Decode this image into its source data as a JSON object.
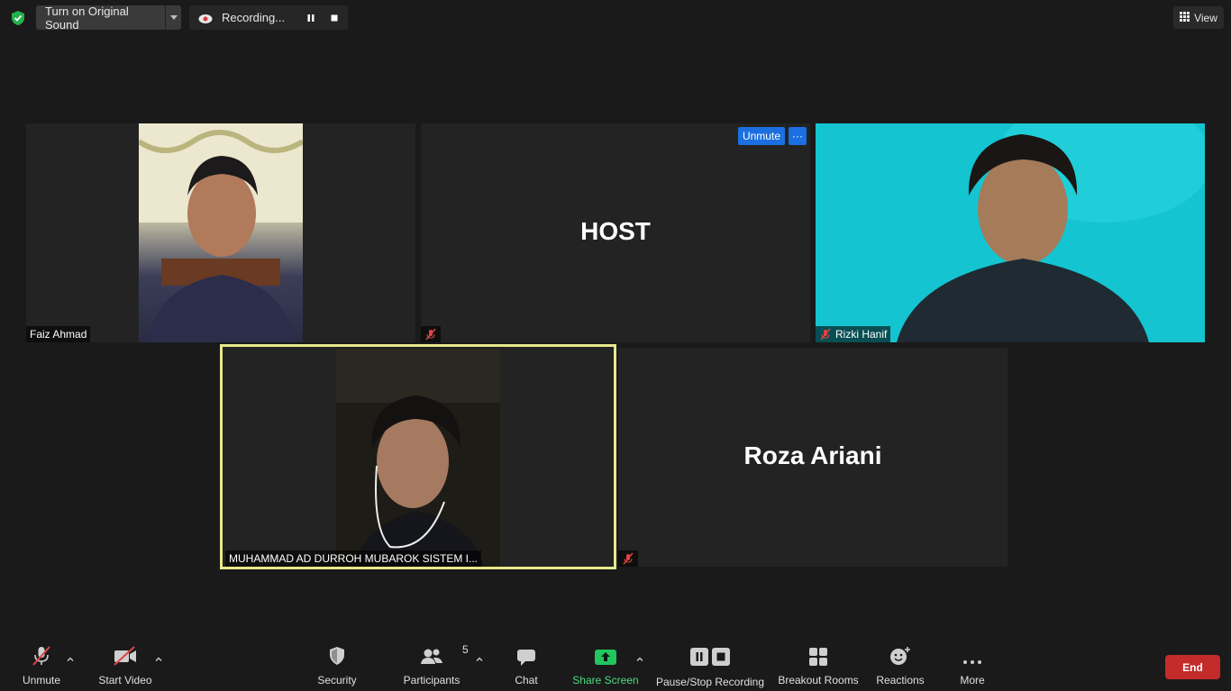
{
  "topbar": {
    "original_sound_label": "Turn on Original Sound",
    "recording_label": "Recording...",
    "view_label": "View"
  },
  "tiles": {
    "faiz": {
      "name": "Faiz Ahmad"
    },
    "host": {
      "name": "HOST",
      "unmute_label": "Unmute",
      "more_label": "···"
    },
    "rizki": {
      "name": "Rizki Hanif"
    },
    "muhammad": {
      "name": "MUHAMMAD AD DURROH MUBAROK SISTEM I..."
    },
    "roza": {
      "name": "Roza Ariani"
    }
  },
  "toolbar": {
    "unmute": "Unmute",
    "start_video": "Start Video",
    "security": "Security",
    "participants": "Participants",
    "participants_count": "5",
    "chat": "Chat",
    "share_screen": "Share Screen",
    "pause_stop_recording": "Pause/Stop Recording",
    "breakout_rooms": "Breakout Rooms",
    "reactions": "Reactions",
    "more": "More",
    "end": "End"
  },
  "colors": {
    "background": "#1a1a1a",
    "active_speaker_border": "#e6e88c",
    "share_screen_green": "#22c55e",
    "end_red": "#c42b2b",
    "unmute_blue": "#1b6fe0",
    "muted_red": "#e04444"
  }
}
